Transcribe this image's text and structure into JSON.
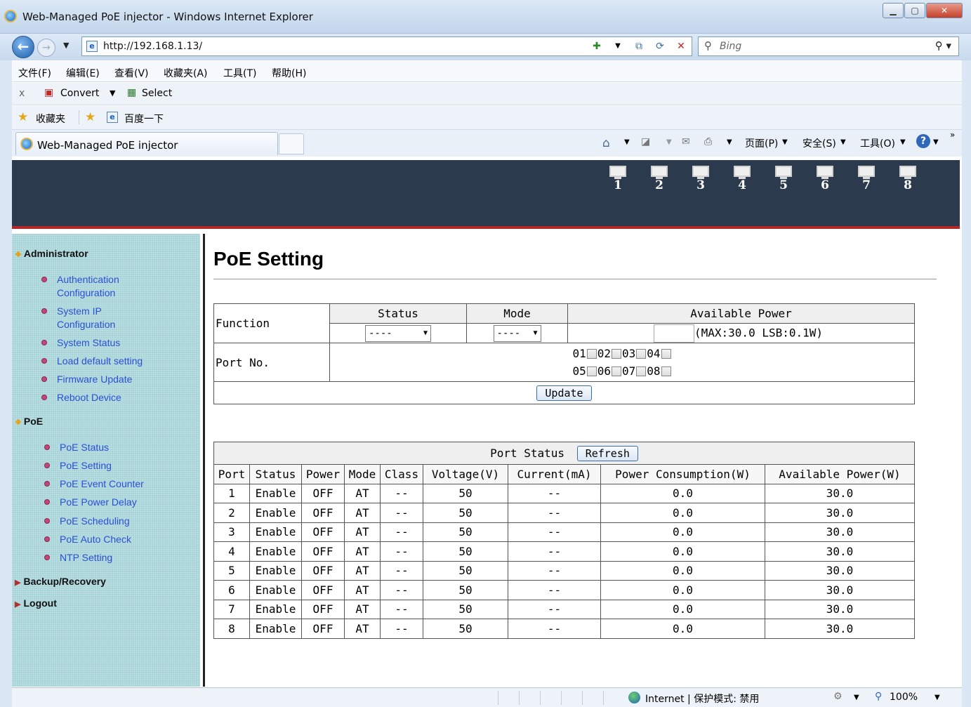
{
  "window": {
    "title": "Web-Managed PoE injector - Windows Internet Explorer",
    "url": "http://192.168.1.13/",
    "search_placeholder": "Bing",
    "tab_title": "Web-Managed PoE injector"
  },
  "menubar": [
    "文件(F)",
    "编辑(E)",
    "查看(V)",
    "收藏夹(A)",
    "工具(T)",
    "帮助(H)"
  ],
  "convert_bar": {
    "close": "x",
    "convert": "Convert",
    "select": "Select"
  },
  "favorites_bar": {
    "favorites": "收藏夹",
    "baidu": "百度一下"
  },
  "command_bar": {
    "page": "页面(P)",
    "safety": "安全(S)",
    "tools": "工具(O)"
  },
  "banner_ports": [
    "1",
    "2",
    "3",
    "4",
    "5",
    "6",
    "7",
    "8"
  ],
  "sidebar": {
    "administrator": "Administrator",
    "admin_items": [
      {
        "line1": "Authentication",
        "line2": "Configuration"
      },
      {
        "line1": "System IP",
        "line2": "Configuration"
      },
      {
        "line1": "System Status"
      },
      {
        "line1": "Load default setting"
      },
      {
        "line1": "Firmware Update"
      },
      {
        "line1": "Reboot Device"
      }
    ],
    "poe": "PoE",
    "poe_items": [
      "PoE Status",
      "PoE Setting",
      "PoE Event Counter",
      "PoE Power Delay",
      "PoE Scheduling",
      "PoE Auto Check",
      "NTP Setting"
    ],
    "backup": "Backup/Recovery",
    "logout": "Logout"
  },
  "main": {
    "title": "PoE Setting",
    "setting": {
      "function_label": "Function",
      "status_header": "Status",
      "mode_header": "Mode",
      "available_power_header": "Available Power",
      "status_value": "----",
      "mode_value": "----",
      "power_hint": "(MAX:30.0 LSB:0.1W)",
      "port_no_label": "Port No.",
      "ports_row1": [
        "01",
        "02",
        "03",
        "04"
      ],
      "ports_row2": [
        "05",
        "06",
        "07",
        "08"
      ],
      "update_button": "Update"
    },
    "port_status": {
      "title": "Port Status",
      "refresh_button": "Refresh",
      "columns": [
        "Port",
        "Status",
        "Power",
        "Mode",
        "Class",
        "Voltage(V)",
        "Current(mA)",
        "Power Consumption(W)",
        "Available Power(W)"
      ],
      "rows": [
        [
          "1",
          "Enable",
          "OFF",
          "AT",
          "--",
          "50",
          "--",
          "0.0",
          "30.0"
        ],
        [
          "2",
          "Enable",
          "OFF",
          "AT",
          "--",
          "50",
          "--",
          "0.0",
          "30.0"
        ],
        [
          "3",
          "Enable",
          "OFF",
          "AT",
          "--",
          "50",
          "--",
          "0.0",
          "30.0"
        ],
        [
          "4",
          "Enable",
          "OFF",
          "AT",
          "--",
          "50",
          "--",
          "0.0",
          "30.0"
        ],
        [
          "5",
          "Enable",
          "OFF",
          "AT",
          "--",
          "50",
          "--",
          "0.0",
          "30.0"
        ],
        [
          "6",
          "Enable",
          "OFF",
          "AT",
          "--",
          "50",
          "--",
          "0.0",
          "30.0"
        ],
        [
          "7",
          "Enable",
          "OFF",
          "AT",
          "--",
          "50",
          "--",
          "0.0",
          "30.0"
        ],
        [
          "8",
          "Enable",
          "OFF",
          "AT",
          "--",
          "50",
          "--",
          "0.0",
          "30.0"
        ]
      ]
    }
  },
  "statusbar": {
    "zone": "Internet | 保护模式: 禁用",
    "zoom": "100%"
  }
}
